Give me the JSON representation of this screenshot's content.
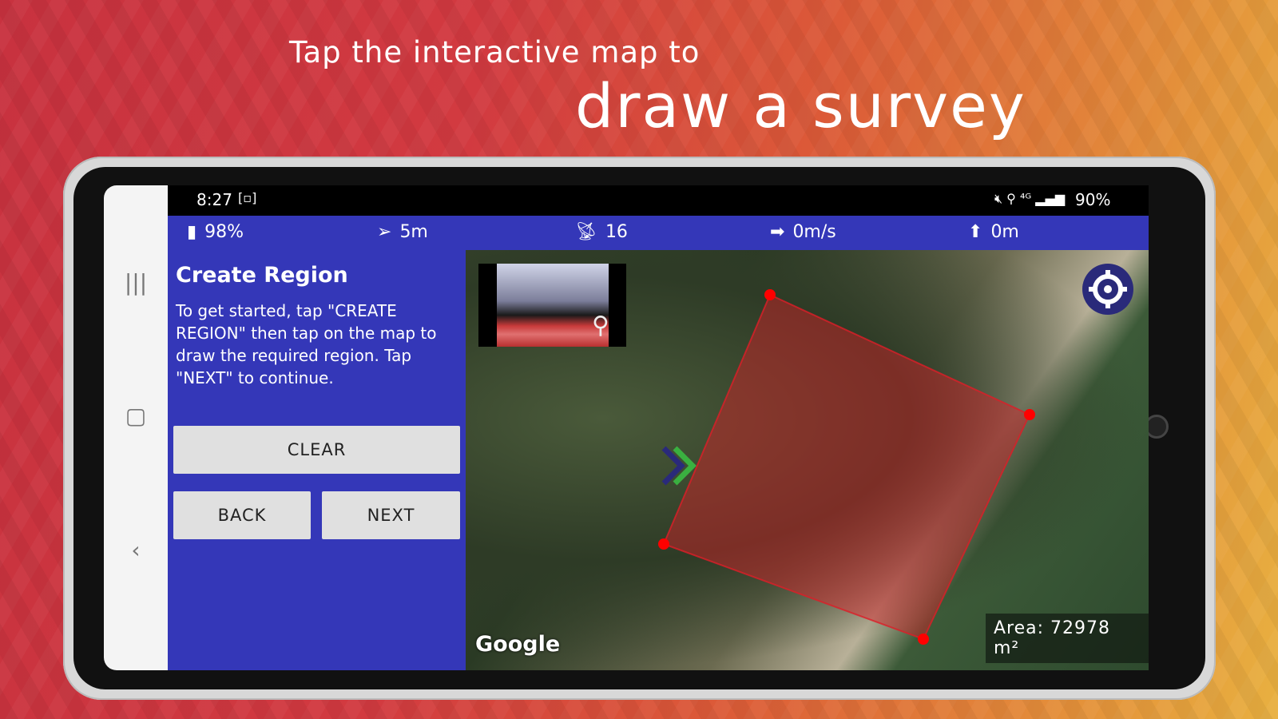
{
  "promo": {
    "line1": "Tap the interactive map to",
    "line2": "draw a survey"
  },
  "status_bar": {
    "time": "8:27",
    "battery": "90%"
  },
  "telemetry": {
    "battery": "98%",
    "distance": "5m",
    "satellites": "16",
    "speed": "0m/s",
    "altitude": "0m"
  },
  "panel": {
    "title": "Create Region",
    "instructions": "To get started, tap \"CREATE REGION\" then tap on the map to draw the required region.  Tap \"NEXT\" to continue.",
    "clear_label": "CLEAR",
    "back_label": "BACK",
    "next_label": "NEXT"
  },
  "map": {
    "attribution": "Google",
    "area": "Area: 72978 m²",
    "region_color": "#ff0000",
    "accent": "#3437b8"
  }
}
